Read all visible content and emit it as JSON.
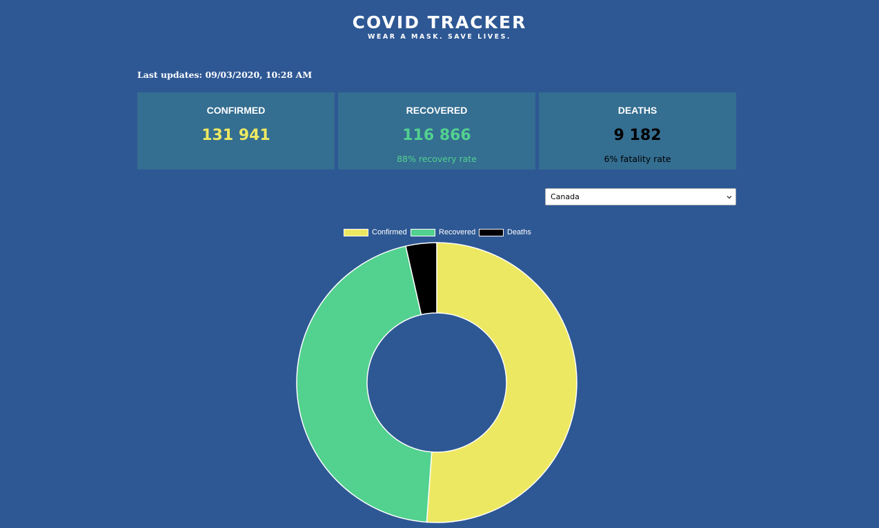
{
  "header": {
    "title": "COVID TRACKER",
    "tagline": "WEAR A MASK. SAVE LIVES."
  },
  "last_updated": "Last updates: 09/03/2020, 10:28 AM",
  "cards": {
    "confirmed": {
      "title": "CONFIRMED",
      "value": "131 941",
      "color": "#ede861"
    },
    "recovered": {
      "title": "RECOVERED",
      "value": "116 866",
      "rate": "88% recovery rate",
      "color": "#52d18f"
    },
    "deaths": {
      "title": "DEATHS",
      "value": "9 182",
      "rate": "6% fatality rate",
      "color": "#000000"
    }
  },
  "country_select": {
    "selected": "Canada"
  },
  "colors": {
    "background": "#2e5894",
    "card_bg": "#346e91"
  },
  "chart_data": {
    "type": "pie",
    "variant": "doughnut",
    "categories": [
      "Confirmed",
      "Recovered",
      "Deaths"
    ],
    "values": [
      131941,
      116866,
      9182
    ],
    "colors": [
      "#ede861",
      "#52d18f",
      "#000000"
    ],
    "legend": "top",
    "title": ""
  }
}
